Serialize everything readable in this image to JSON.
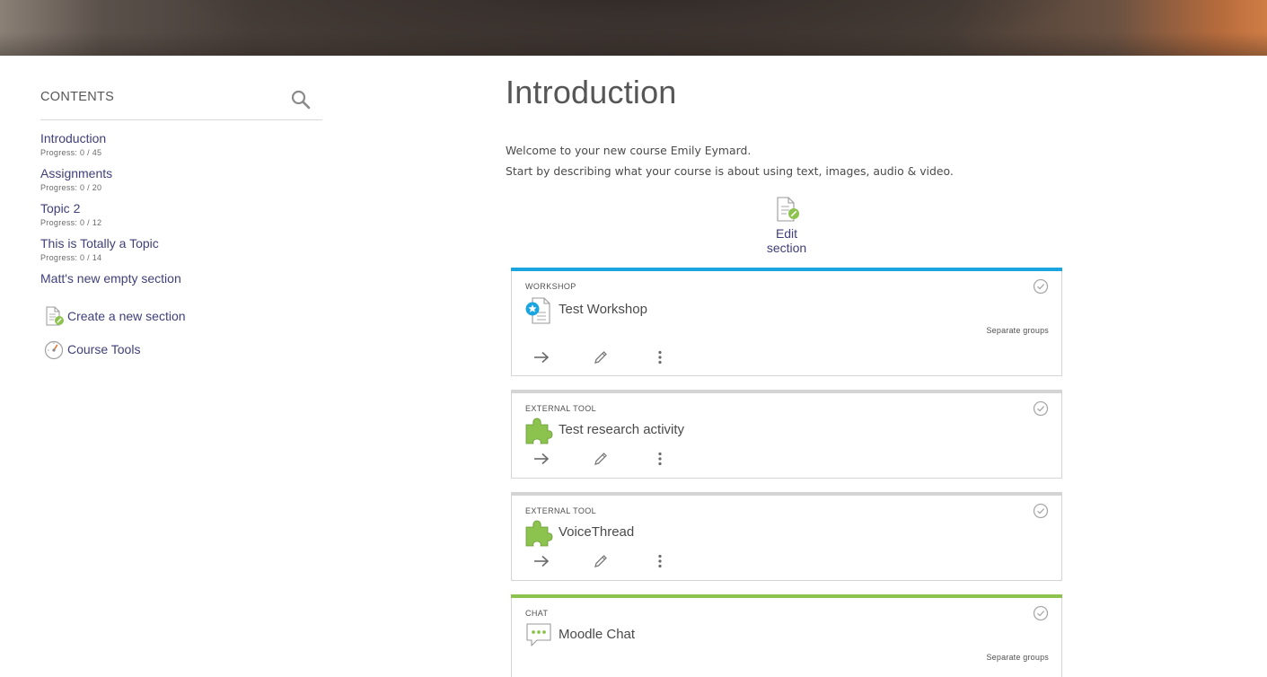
{
  "sidebar": {
    "title": "CONTENTS",
    "sections": [
      {
        "label": "Introduction",
        "progress": "Progress: 0 / 45"
      },
      {
        "label": "Assignments",
        "progress": "Progress: 0 / 20"
      },
      {
        "label": "Topic 2",
        "progress": "Progress: 0 / 12"
      },
      {
        "label": "This is Totally a Topic",
        "progress": "Progress: 0 / 14"
      },
      {
        "label": "Matt's new empty section"
      }
    ],
    "actions": {
      "create_section": "Create a new section",
      "course_tools": "Course Tools"
    }
  },
  "main": {
    "title": "Introduction",
    "intro_lines": [
      "Welcome to your new course Emily Eymard.",
      "Start by describing what your course is about using text, images, audio & video."
    ],
    "edit_section": "Edit section",
    "activities": [
      {
        "type": "WORKSHOP",
        "name": "Test Workshop",
        "groups": "Separate groups",
        "accent": "#1aa5e0"
      },
      {
        "type": "EXTERNAL TOOL",
        "name": "Test research activity",
        "accent": "#d4d4d4"
      },
      {
        "type": "EXTERNAL TOOL",
        "name": "VoiceThread",
        "accent": "#d4d4d4"
      },
      {
        "type": "CHAT",
        "name": "Moodle Chat",
        "groups": "Separate groups",
        "accent": "#8cc34e"
      }
    ]
  },
  "colors": {
    "link": "#3f3f7a",
    "text": "#565656",
    "workshop_accent": "#1aa5e0",
    "chat_accent": "#8cc34e",
    "puzzle_green": "#8cc34e"
  },
  "icons": {
    "search": "search-icon",
    "edit_doc": "edit-document-icon",
    "course_tools": "gauge-icon",
    "workshop": "workshop-icon",
    "external_tool": "puzzle-piece-icon",
    "chat": "chat-bubble-icon",
    "arrow": "arrow-right-icon",
    "pencil": "pencil-icon",
    "more": "more-vertical-icon",
    "completion": "completion-check-icon"
  }
}
